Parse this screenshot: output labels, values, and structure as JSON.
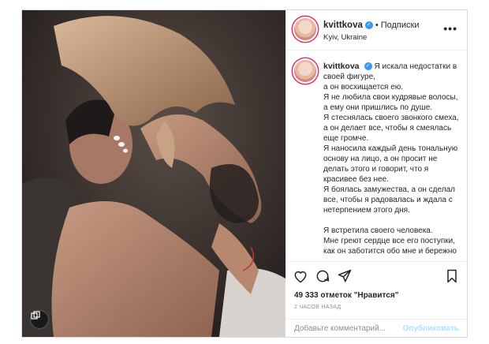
{
  "post": {
    "username": "kvittkova",
    "follow_label": "Подписки",
    "location": "Kyiv, Ukraine",
    "more_label": "•••",
    "caption": [
      "Я искала недостатки в своей фигуре,",
      "а он восхищается ею.",
      "Я не любила свои кудрявые волосы, а ему они пришлись по душе.",
      "Я стеснялась своего звонкого смеха, а он делает все, чтобы я смеялась еще громче.",
      "Я наносила каждый день тональную основу на лицо, а он просит не делать этого и говорит, что я красивее без нее.",
      "Я боялась замужества, а он сделал все, чтобы я радовалась и ждала с нетерпением этого дня.",
      "",
      "Я встретила своего человека.",
      "Мне греют сердце все его поступки, как он заботится обо мне и бережно"
    ],
    "likes": "49 333 отметок \"Нравится\"",
    "time": "2 ЧАСОВ НАЗАД",
    "comment_placeholder": "Добавьте комментарий...",
    "publish_label": "Опубликовать"
  },
  "icons": {
    "verified": "verified-badge-icon",
    "like": "heart-icon",
    "comment": "comment-icon",
    "share": "share-icon",
    "save": "bookmark-icon",
    "multi": "multiple-images-icon"
  },
  "colors": {
    "verified": "#3897f0",
    "publish_disabled": "#b2dffc",
    "muted": "#8e8e8e",
    "border": "#dbdbdb"
  }
}
